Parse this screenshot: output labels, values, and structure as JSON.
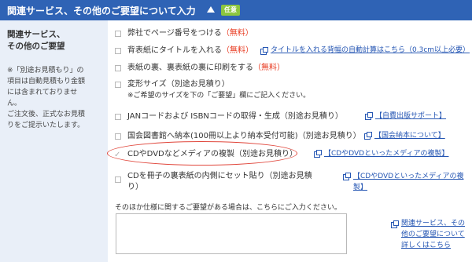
{
  "header": {
    "title": "関連サービス、その他のご要望について入力",
    "badge": "任意"
  },
  "sidebar": {
    "title_line1": "関連サービス、",
    "title_line2": "その他のご要望",
    "note_lines": [
      "※「別途お見積もり」の",
      "項目は自動見積もり金額",
      "には含まれておりませ",
      "ん。",
      "ご注文後、正式なお見積",
      "りをご提示いたします。"
    ]
  },
  "options": [
    {
      "label": "弊社でページ番号をつける",
      "free": "（無料）"
    },
    {
      "label": "背表紙にタイトルを入れる",
      "free": "（無料）",
      "link": "タイトルを入れる背幅の自動計算はこちら（0.3cm以上必要）"
    },
    {
      "label": "表紙の裏、裏表紙の裏に印刷をする",
      "free": "（無料）"
    },
    {
      "label": "変形サイズ（別途お見積り）",
      "note": "※ご希望のサイズを下の「ご要望」欄にご記入ください。"
    },
    {
      "label": "JANコードおよび ISBNコードの取得・生成（別途お見積り）",
      "link": "【自費出版サポート】"
    },
    {
      "label": "国会図書館へ納本(100冊以上より納本受付可能)（別途お見積り）",
      "link": "【国会納本について】"
    },
    {
      "label": "CDやDVDなどメディアの複製（別途お見積り）",
      "link": "【CDやDVDといったメディアの複製】"
    },
    {
      "label_line1": "CDを冊子の裏表紙の内側にセット貼り（別途お見積",
      "label_line2": "り）",
      "link_line1": "【CDやDVDといったメディアの複",
      "link_line2": "製】"
    }
  ],
  "textarea": {
    "label": "そのほか仕様に関するご要望がある場合は、こちらにご入力ください。",
    "value": ""
  },
  "side_link": {
    "line1": "関連サービス、その",
    "line2": "他のご要望について",
    "line3": "詳しくはこちら"
  },
  "colors": {
    "header_bg": "#2f63b5",
    "sidebar_bg": "#e9eff8",
    "free_text": "#e8381e",
    "link": "#2556b3",
    "highlight": "#e0463b",
    "badge": "#8cc63f"
  }
}
